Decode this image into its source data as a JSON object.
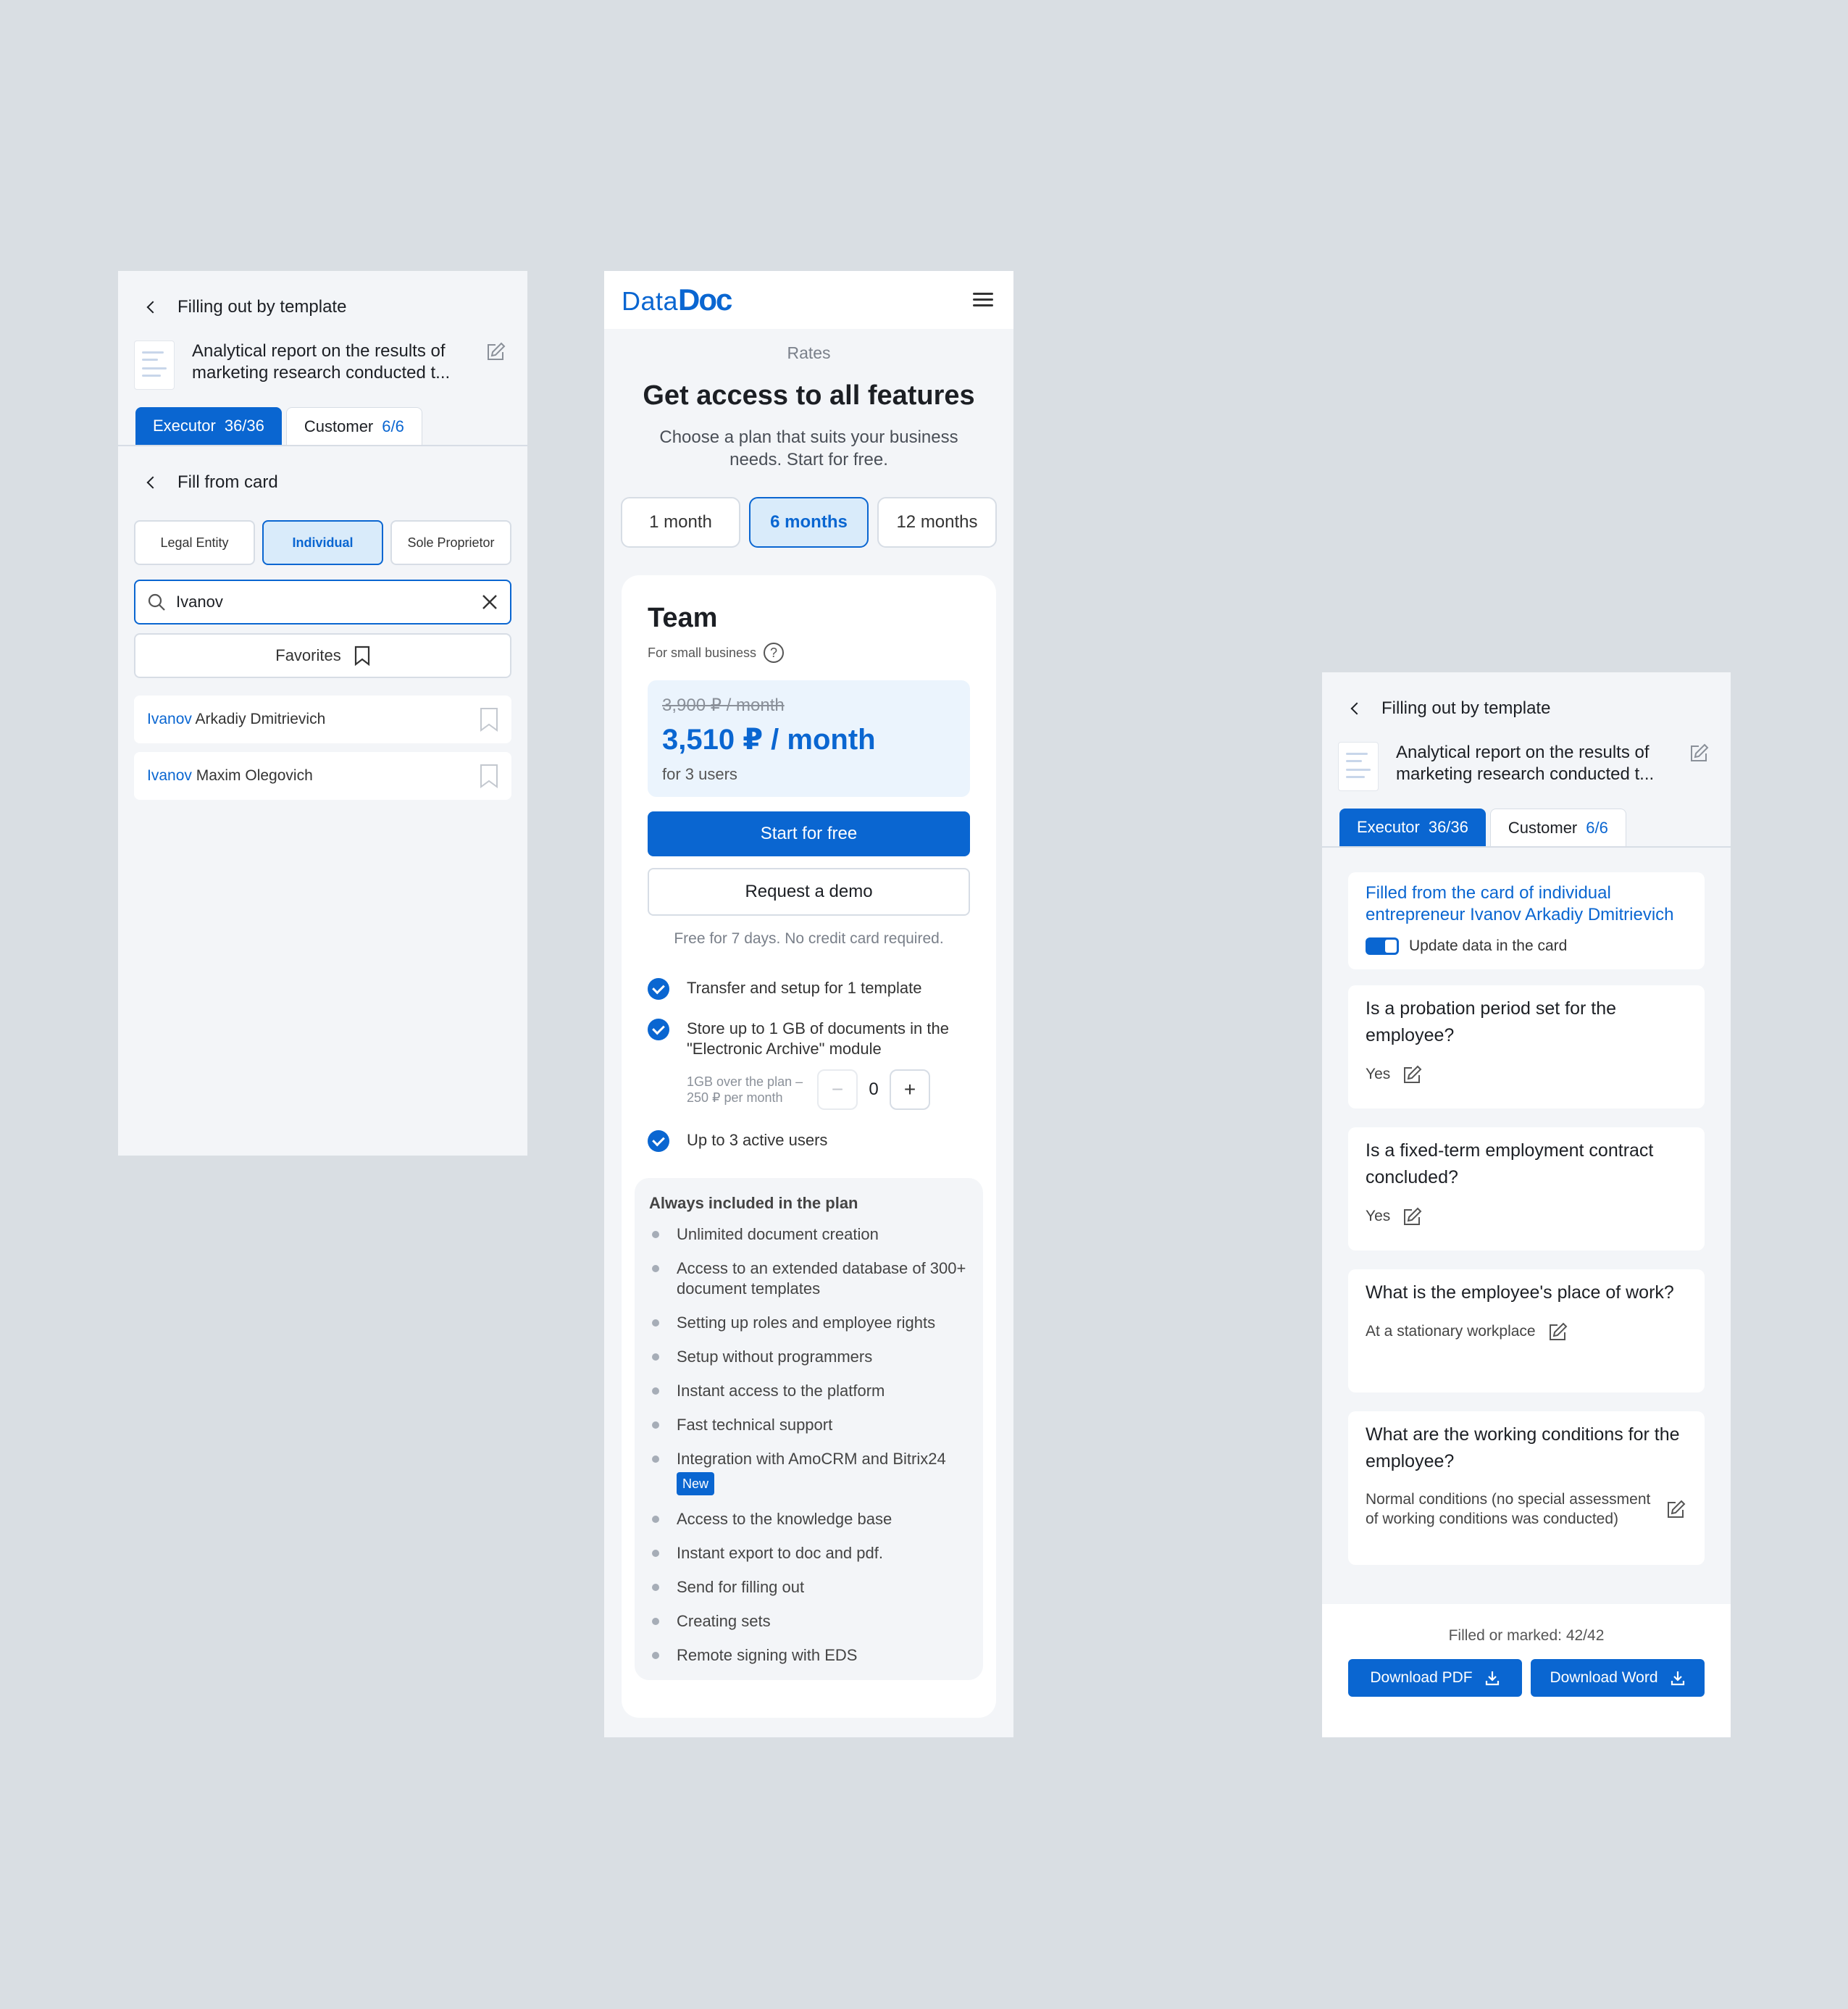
{
  "left": {
    "back_title": "Filling out by template",
    "doc_title": "Analytical report on the results of marketing research conducted t...",
    "tabs": [
      {
        "label": "Executor",
        "count": "36/36"
      },
      {
        "label": "Customer",
        "count": "6/6"
      }
    ],
    "fill_from_card": "Fill from card",
    "segments": [
      "Legal Entity",
      "Individual",
      "Sole Proprietor"
    ],
    "search_value": "Ivanov",
    "favorites_label": "Favorites",
    "results": [
      {
        "highlight": "Ivanov",
        "rest": " Arkadiy Dmitrievich"
      },
      {
        "highlight": "Ivanov",
        "rest": " Maxim Olegovich"
      }
    ]
  },
  "mid": {
    "logo_data": "Data",
    "logo_doc": "Doc",
    "rates": "Rates",
    "title": "Get access to all features",
    "subtitle": "Choose a plan that suits your business needs. Start for free.",
    "periods": [
      "1 month",
      "6 months",
      "12 months"
    ],
    "plan": {
      "name": "Team",
      "sub": "For small business",
      "old_price": "3,900 ₽ / month",
      "new_price": "3,510 ₽ / month",
      "users": "for 3 users",
      "start_label": "Start for free",
      "demo_label": "Request a demo",
      "note": "Free for 7 days. No credit card required.",
      "features": [
        "Transfer and setup for 1 template",
        "Store up to 1 GB of documents in the \"Electronic Archive\" module",
        "Up to 3 active users"
      ],
      "stepper_note": "1GB over the plan – 250 ₽ per month",
      "stepper_value": "0",
      "stepper_minus": "−",
      "stepper_plus": "+"
    },
    "included_title": "Always included in the plan",
    "included": [
      "Unlimited document creation",
      "Access to an extended database of 300+ document templates",
      "Setting up roles and employee rights",
      "Setup without programmers",
      "Instant access to the platform",
      "Fast technical support",
      "Integration with AmoCRM and Bitrix24",
      "Access to the knowledge base",
      "Instant export to doc and pdf.",
      "Send for filling out",
      "Creating sets",
      "Remote signing with EDS"
    ],
    "new_badge": "New"
  },
  "right": {
    "back_title": "Filling out by template",
    "doc_title": "Analytical report on the results of marketing research conducted t...",
    "tabs": [
      {
        "label": "Executor",
        "count": "36/36"
      },
      {
        "label": "Customer",
        "count": "6/6"
      }
    ],
    "filled_from": "Filled from the card of individual entrepreneur Ivanov Arkadiy Dmitrievich",
    "update_toggle": "Update data in the card",
    "questions": [
      {
        "q": "Is a probation period set for the employee?",
        "a": "Yes"
      },
      {
        "q": "Is a fixed-term employment contract concluded?",
        "a": "Yes"
      },
      {
        "q": "What is the employee's place of work?",
        "a": "At a stationary workplace"
      },
      {
        "q": "What are the working conditions for the employee?",
        "a": "Normal conditions (no special assessment of working conditions was conducted)"
      }
    ],
    "counter": "Filled or marked: 42/42",
    "download_pdf": "Download PDF",
    "download_word": "Download Word"
  },
  "colors": {
    "accent": "#0a66d1",
    "background": "#d9dee3",
    "panel": "#f3f5f8"
  }
}
